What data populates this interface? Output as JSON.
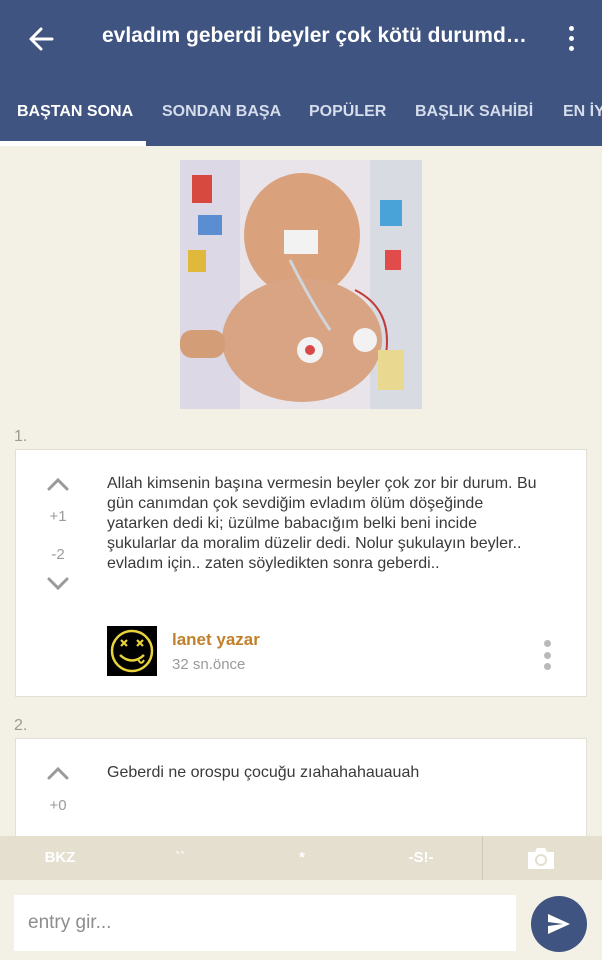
{
  "header": {
    "title": "evladım geberdi beyler çok kötü durumdayım",
    "back_icon": "arrow-left-icon",
    "menu_icon": "more-vert-icon",
    "background_color": "#3f5480"
  },
  "tabs": [
    {
      "label": "BAŞTAN SONA",
      "active": true
    },
    {
      "label": "SONDAN BAŞA",
      "active": false
    },
    {
      "label": "POPÜLER",
      "active": false
    },
    {
      "label": "BAŞLIK SAHİBİ",
      "active": false
    },
    {
      "label": "EN İYİ",
      "active": false
    }
  ],
  "entries": [
    {
      "number": "1.",
      "upvotes": "+1",
      "downvotes": "-2",
      "text": "Allah kimsenin başına vermesin beyler çok zor bir durum. Bu gün canımdan çok sevdiğim evladım ölüm döşeğinde yatarken dedi ki; üzülme babacığım belki beni incide şukularlar da moralim düzelir dedi. Nolur şukulayın beyler.. evladım için.. zaten söyledikten sonra geberdi..",
      "author": "lanet yazar",
      "time": "32 sn.önce",
      "author_color": "#c2802b"
    },
    {
      "number": "2.",
      "upvotes": "+0",
      "text": "Geberdi ne orospu çocuğu zıahahahauauah"
    }
  ],
  "toolbar": {
    "bkz": "BKZ",
    "backtick": "``",
    "star": "*",
    "spoiler": "-S!-",
    "camera_icon": "camera-icon"
  },
  "composer": {
    "placeholder": "entry gir...",
    "send_icon": "send-icon"
  }
}
